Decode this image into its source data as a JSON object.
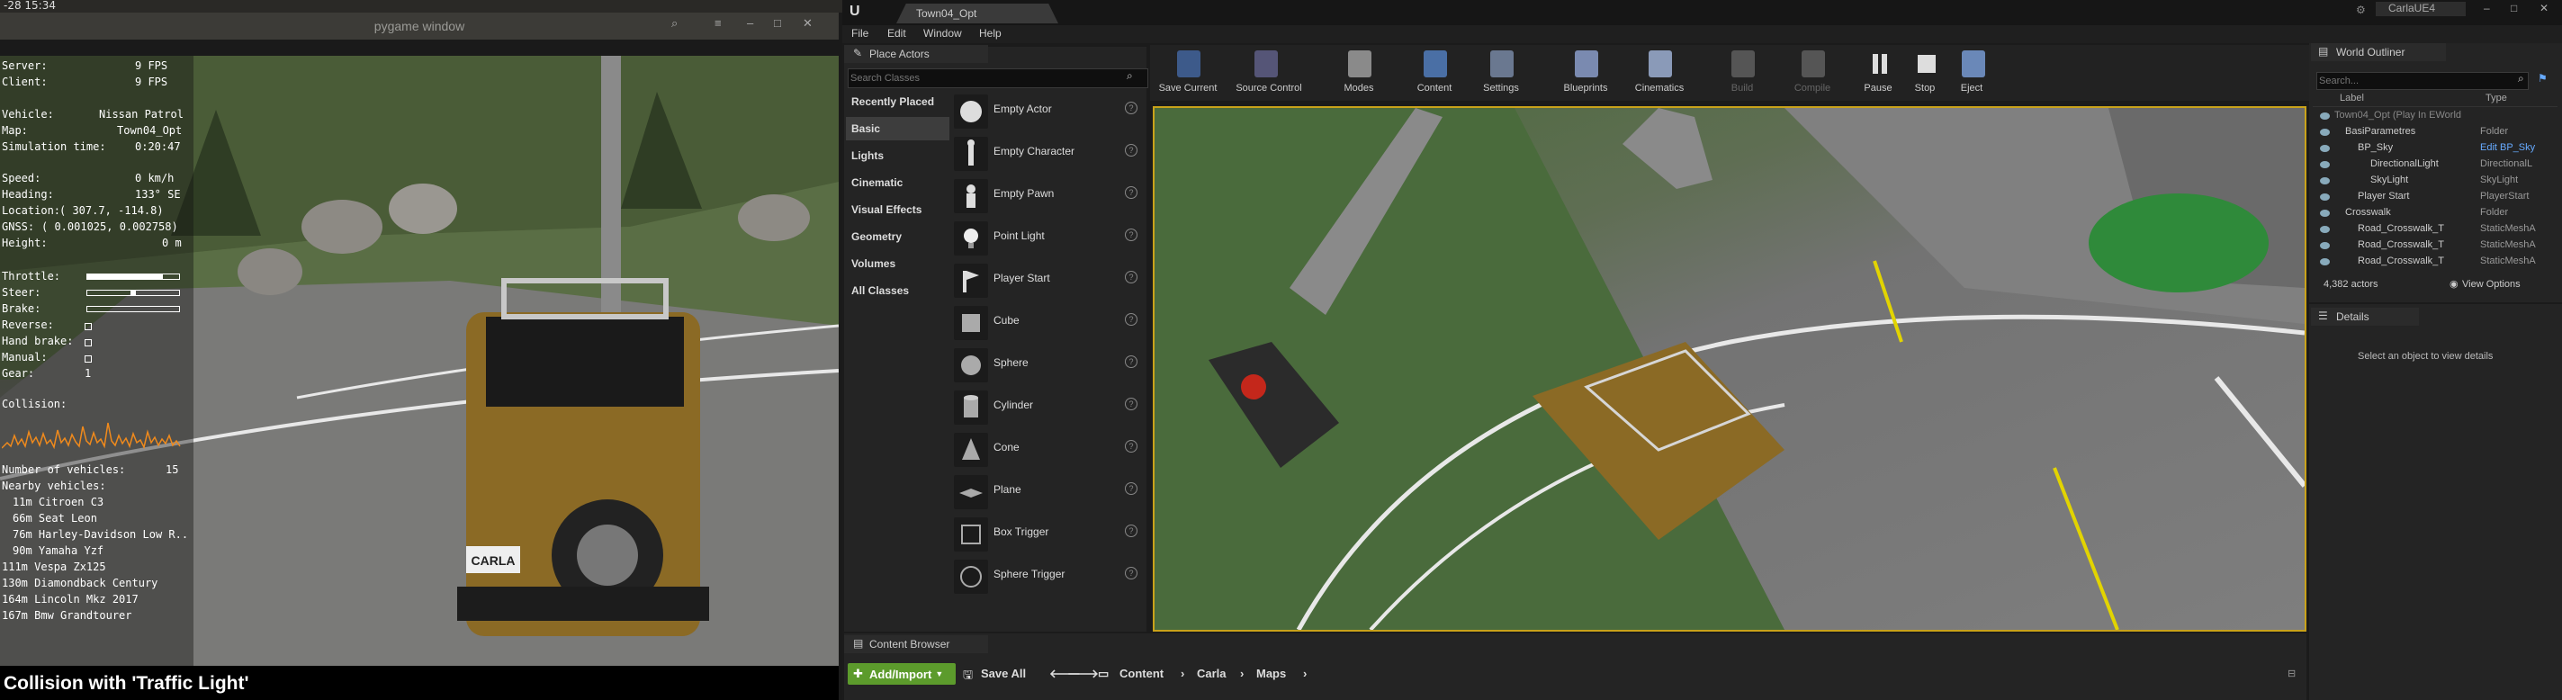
{
  "system": {
    "clock": "-28 15:34"
  },
  "pygame": {
    "title": "pygame window",
    "stats": [
      {
        "label": "Server:",
        "value": "9 FPS"
      },
      {
        "label": "Client:",
        "value": "9 FPS"
      },
      {
        "label": "Vehicle:",
        "value": "Nissan Patrol"
      },
      {
        "label": "Map:",
        "value": "Town04_Opt"
      },
      {
        "label": "Simulation time:",
        "value": "0:20:47"
      },
      {
        "label": "Speed:",
        "value": "0 km/h"
      },
      {
        "label": "Heading:",
        "value": "133° SE"
      },
      {
        "label": "Location:",
        "value": "( 307.7, -114.8)"
      },
      {
        "label": "GNSS:",
        "value": "( 0.001025, 0.002758)"
      },
      {
        "label": "Height:",
        "value": "0 m"
      }
    ],
    "controls": {
      "throttle": {
        "label": "Throttle:",
        "level": 0.82
      },
      "steer": {
        "label": "Steer:",
        "level": 0.5
      },
      "brake": {
        "label": "Brake:",
        "level": 0.0
      },
      "reverse": "Reverse:",
      "hand_brake": "Hand brake:",
      "manual": "Manual:",
      "gear_label": "Gear:",
      "gear_value": "1"
    },
    "collision_label": "Collision:",
    "vehicles_label": "Number of vehicles:",
    "vehicles_count": "15",
    "nearby_label": "Nearby vehicles:",
    "nearby": [
      "11m Citroen C3",
      "66m Seat Leon",
      "76m Harley-Davidson Low R..",
      "90m Yamaha Yzf",
      "111m Vespa Zx125",
      "130m Diamondback Century",
      "164m Lincoln Mkz 2017",
      "167m Bmw Grandtourer"
    ],
    "plate": "CARLA",
    "notification": "Collision with 'Traffic Light'"
  },
  "ue": {
    "tab": "Town04_Opt",
    "project": "CarlaUE4",
    "menus": [
      "File",
      "Edit",
      "Window",
      "Help"
    ],
    "place_actors": {
      "title": "Place Actors",
      "search_placeholder": "Search Classes",
      "categories": [
        "Recently Placed",
        "Basic",
        "Lights",
        "Cinematic",
        "Visual Effects",
        "Geometry",
        "Volumes",
        "All Classes"
      ],
      "items": [
        "Empty Actor",
        "Empty Character",
        "Empty Pawn",
        "Point Light",
        "Player Start",
        "Cube",
        "Sphere",
        "Cylinder",
        "Cone",
        "Plane",
        "Box Trigger",
        "Sphere Trigger"
      ]
    },
    "toolbar": [
      "Save Current",
      "Source Control",
      "Modes",
      "Content",
      "Settings",
      "Blueprints",
      "Cinematics",
      "Build",
      "Compile",
      "Pause",
      "Stop",
      "Eject"
    ],
    "content_browser": {
      "title": "Content Browser",
      "add_import": "Add/Import",
      "save_all": "Save All",
      "path": [
        "Content",
        "Carla",
        "Maps"
      ]
    },
    "world_outliner": {
      "title": "World Outliner",
      "search_placeholder": "Search...",
      "col_label": "Label",
      "col_type": "Type",
      "rows": [
        {
          "name": "Town04_Opt (Play In EWorld",
          "type": ""
        },
        {
          "name": "BasiParametres",
          "type": "Folder"
        },
        {
          "name": "BP_Sky",
          "type": "Edit BP_Sky"
        },
        {
          "name": "DirectionalLight",
          "type": "DirectionalL"
        },
        {
          "name": "SkyLight",
          "type": "SkyLight"
        },
        {
          "name": "Player Start",
          "type": "PlayerStart"
        },
        {
          "name": "Crosswalk",
          "type": "Folder"
        },
        {
          "name": "Road_Crosswalk_T",
          "type": "StaticMeshA"
        },
        {
          "name": "Road_Crosswalk_T",
          "type": "StaticMeshA"
        },
        {
          "name": "Road_Crosswalk_T",
          "type": "StaticMeshA"
        }
      ],
      "actor_count": "4,382 actors",
      "view_options": "View Options"
    },
    "details": {
      "title": "Details",
      "empty_message": "Select an object to view details"
    }
  }
}
